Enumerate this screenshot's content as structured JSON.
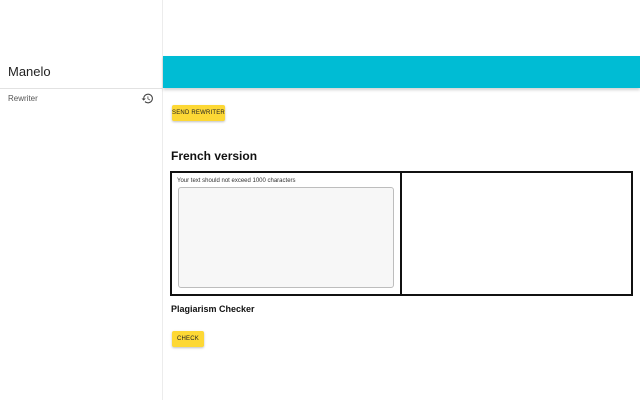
{
  "sidebar": {
    "brand": "Manelo",
    "items": [
      {
        "label": "Rewriter",
        "icon": "history-icon"
      }
    ]
  },
  "topbar": {
    "color": "#00bcd4"
  },
  "main": {
    "send_button_label": "SEND REWRITER",
    "section_title": "French version",
    "input_hint": "Your text should not exceed 1000 characters",
    "input_value": "",
    "output_value": "",
    "plagiarism_title": "Plagiarism Checker",
    "check_button_label": "CHECK",
    "accent_color": "#fdd835"
  }
}
